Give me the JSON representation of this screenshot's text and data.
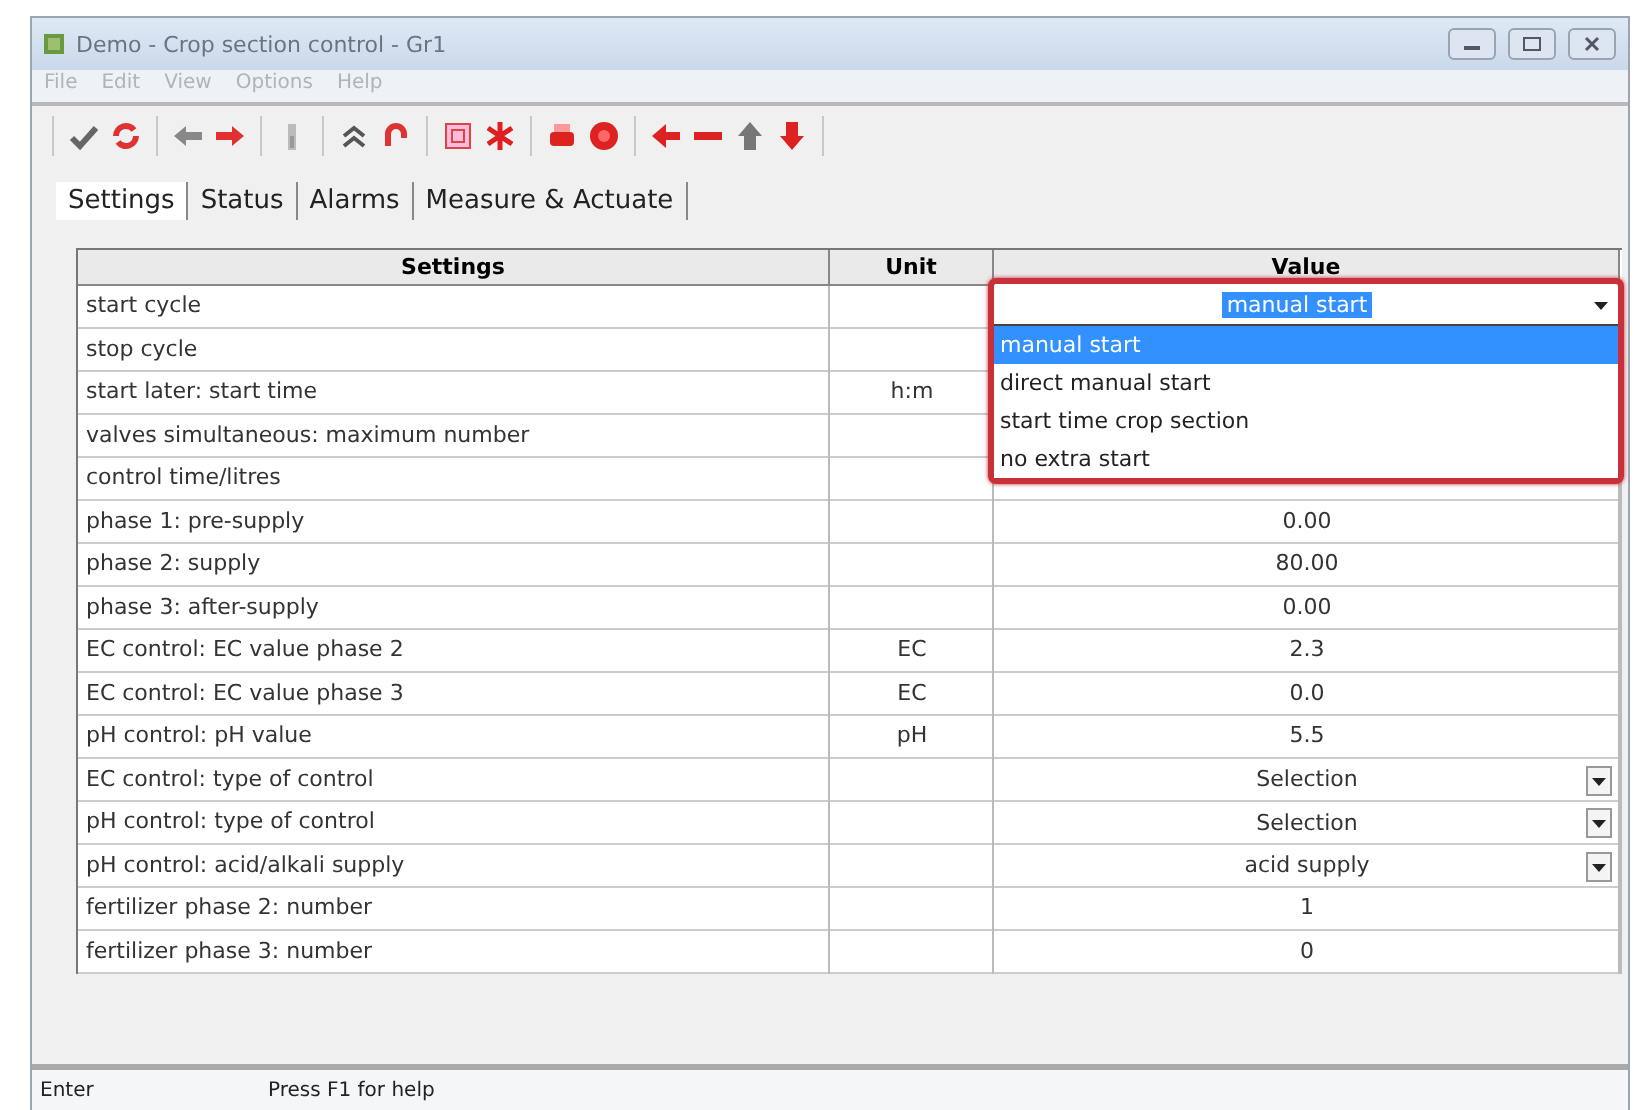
{
  "window": {
    "title": "Demo - Crop section control - Gr1"
  },
  "menu": [
    "File",
    "Edit",
    "View",
    "Options",
    "Help"
  ],
  "tabs": [
    {
      "label": "Settings",
      "selected": true
    },
    {
      "label": "Status",
      "selected": false
    },
    {
      "label": "Alarms",
      "selected": false
    },
    {
      "label": "Measure & Actuate",
      "selected": false
    }
  ],
  "table": {
    "columns": [
      "Settings",
      "Unit",
      "Value"
    ],
    "rows": [
      {
        "setting": "start cycle",
        "unit": "",
        "value": "manual start",
        "kind": "open_select",
        "options": [
          {
            "label": "manual start",
            "selected": true
          },
          {
            "label": "direct manual start",
            "selected": false
          },
          {
            "label": "start time crop section",
            "selected": false
          },
          {
            "label": "no extra start",
            "selected": false
          }
        ]
      },
      {
        "setting": "stop cycle",
        "unit": "",
        "value": "",
        "kind": "text"
      },
      {
        "setting": "start later: start time",
        "unit": "h:m",
        "value": "",
        "kind": "text"
      },
      {
        "setting": "valves simultaneous: maximum number",
        "unit": "",
        "value": "",
        "kind": "text"
      },
      {
        "setting": "control time/litres",
        "unit": "",
        "value": "",
        "kind": "text"
      },
      {
        "setting": "phase 1: pre-supply",
        "unit": "",
        "value": "0.00",
        "kind": "text"
      },
      {
        "setting": "phase 2: supply",
        "unit": "",
        "value": "80.00",
        "kind": "text"
      },
      {
        "setting": "phase 3: after-supply",
        "unit": "",
        "value": "0.00",
        "kind": "text"
      },
      {
        "setting": "EC control: EC value phase 2",
        "unit": "EC",
        "value": "2.3",
        "kind": "text"
      },
      {
        "setting": "EC control: EC value phase 3",
        "unit": "EC",
        "value": "0.0",
        "kind": "text"
      },
      {
        "setting": "pH control: pH value",
        "unit": "pH",
        "value": "5.5",
        "kind": "text"
      },
      {
        "setting": "EC control: type of control",
        "unit": "",
        "value": "Selection",
        "kind": "select"
      },
      {
        "setting": "pH control: type of control",
        "unit": "",
        "value": "Selection",
        "kind": "select"
      },
      {
        "setting": "pH control: acid/alkali supply",
        "unit": "",
        "value": "acid supply",
        "kind": "select"
      },
      {
        "setting": "fertilizer phase 2: number",
        "unit": "",
        "value": "1",
        "kind": "text"
      },
      {
        "setting": "fertilizer phase 3: number",
        "unit": "",
        "value": "0",
        "kind": "text"
      }
    ]
  },
  "status_bar": [
    "Enter",
    "Press F1 for help"
  ]
}
